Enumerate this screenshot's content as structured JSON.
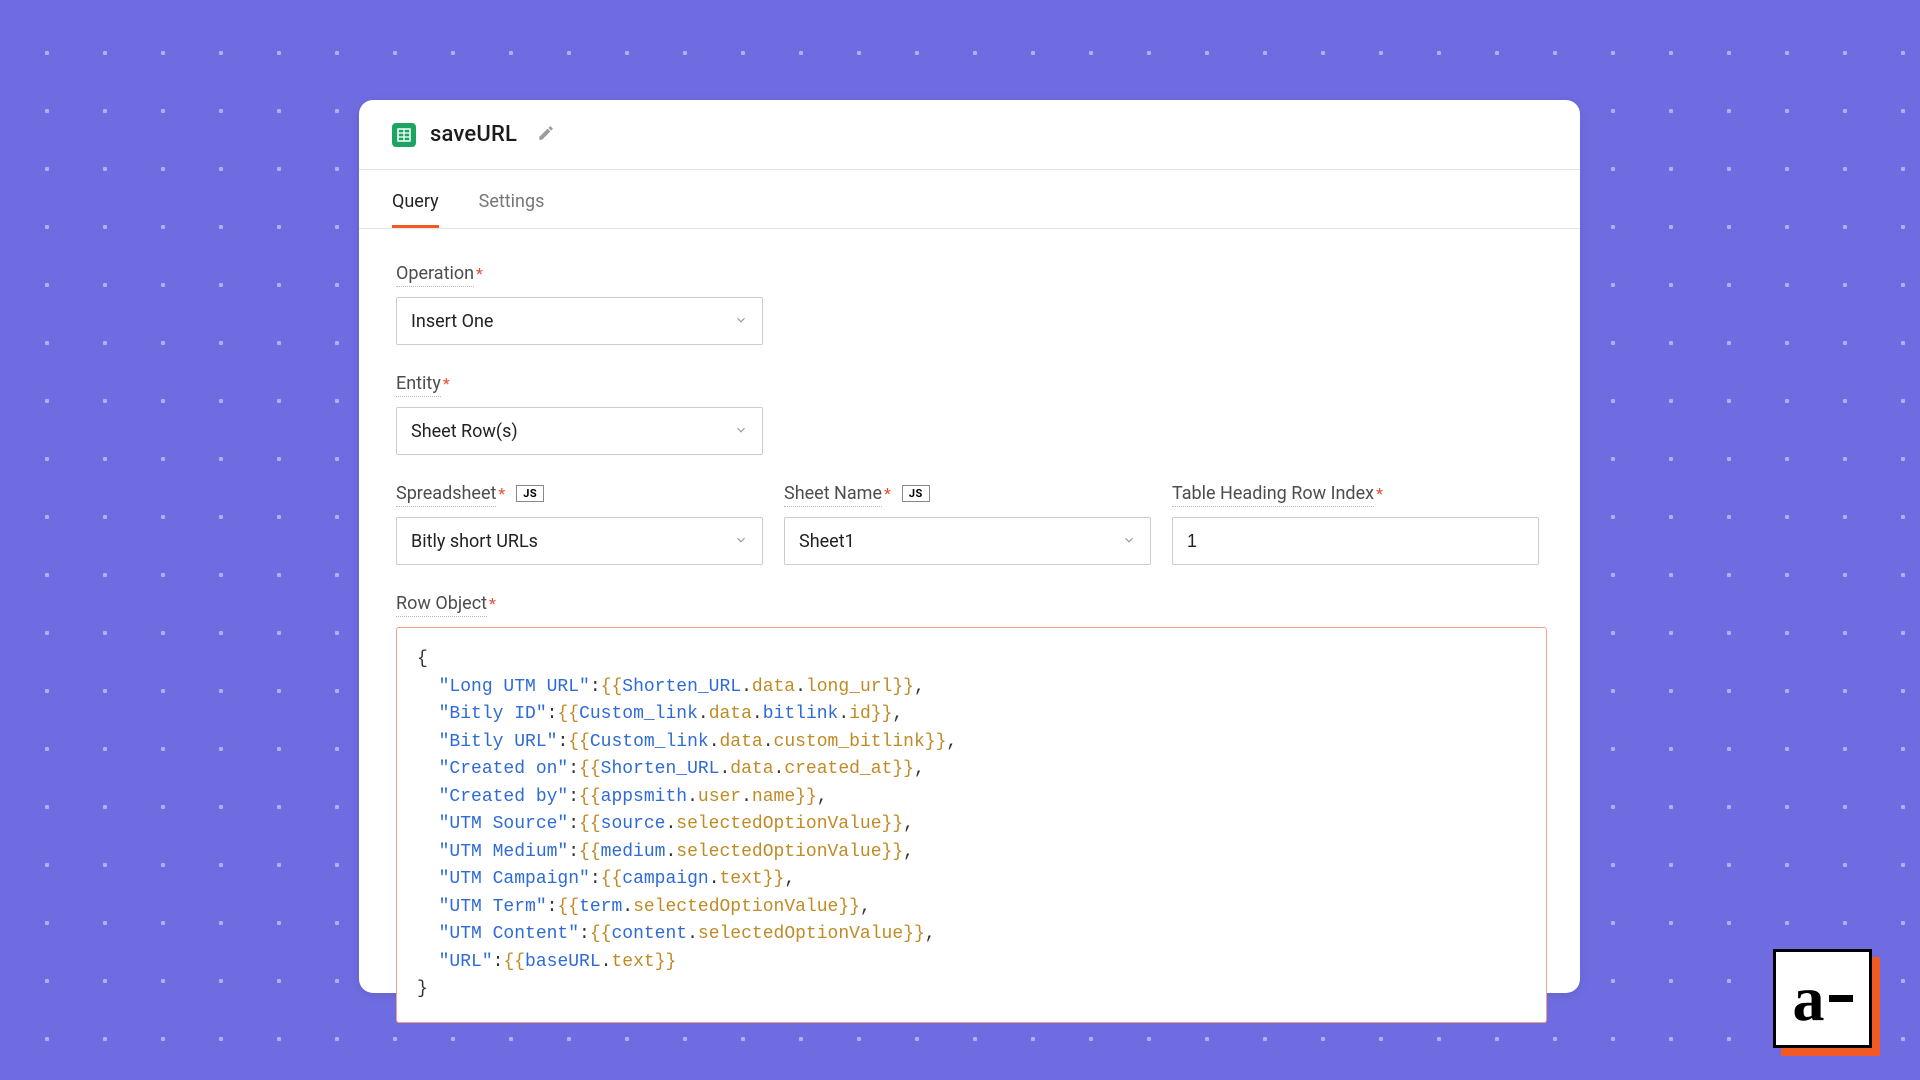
{
  "header": {
    "title": "saveURL"
  },
  "tabs": {
    "query": "Query",
    "settings": "Settings"
  },
  "labels": {
    "operation": "Operation",
    "entity": "Entity",
    "spreadsheet": "Spreadsheet",
    "sheet_name": "Sheet Name",
    "heading_index": "Table Heading Row Index",
    "row_object": "Row Object",
    "js": "JS"
  },
  "values": {
    "operation": "Insert One",
    "entity": "Sheet Row(s)",
    "spreadsheet": "Bitly short URLs",
    "sheet_name": "Sheet1",
    "heading_index": "1"
  },
  "row_object": [
    {
      "key": "Long UTM URL",
      "expr": "Shorten_URL.data.long_url"
    },
    {
      "key": "Bitly ID",
      "expr": "Custom_link.data.bitlink.id"
    },
    {
      "key": "Bitly URL",
      "expr": "Custom_link.data.custom_bitlink"
    },
    {
      "key": "Created on",
      "expr": "Shorten_URL.data.created_at"
    },
    {
      "key": "Created by",
      "expr": "appsmith.user.name"
    },
    {
      "key": "UTM Source",
      "expr": "source.selectedOptionValue"
    },
    {
      "key": "UTM Medium",
      "expr": "medium.selectedOptionValue"
    },
    {
      "key": "UTM Campaign",
      "expr": "campaign.text"
    },
    {
      "key": "UTM Term",
      "expr": "term.selectedOptionValue"
    },
    {
      "key": "UTM Content",
      "expr": "content.selectedOptionValue"
    },
    {
      "key": "URL",
      "expr": "baseURL.text"
    }
  ],
  "logo": {
    "letter": "a"
  }
}
